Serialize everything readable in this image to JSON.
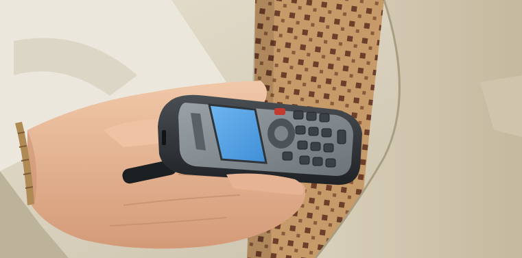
{
  "photo": {
    "subject": "hand-holding-mobile-phone",
    "colors": {
      "suit": "#dcd5c2",
      "suit_shadow": "#b9ae94",
      "shirt": "#e9e6dc",
      "tie": "#c79a6a",
      "tie_pattern": "#6b3f2a",
      "skin": "#e8bc9c",
      "skin_shadow": "#c98e6e",
      "phone_body": "#2b2e31",
      "phone_face": "#7f878c",
      "screen": "#5aa7e8",
      "watch_band": "#b08a55"
    }
  },
  "phone": {
    "display_text": "",
    "keypad_rows": 5,
    "keypad_cols": 3
  }
}
